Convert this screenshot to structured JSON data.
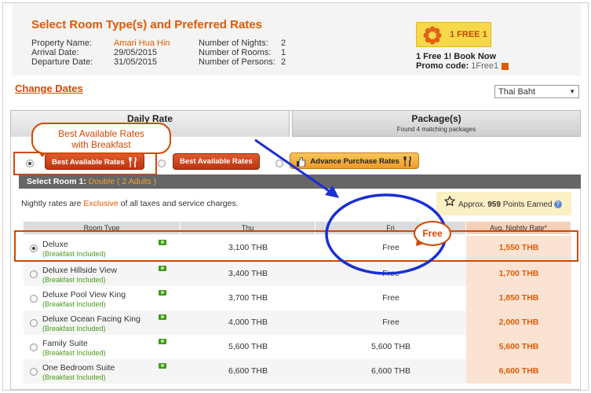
{
  "header": {
    "title": "Select Room Type(s) and Preferred Rates",
    "property_label": "Property Name:",
    "property_value": "Amari Hua Hin",
    "arrival_label": "Arrival Date:",
    "arrival_value": "29/05/2015",
    "departure_label": "Departure Date:",
    "departure_value": "31/05/2015",
    "nights_label": "Number of Nights:",
    "nights_value": "2",
    "rooms_label": "Number of Rooms:",
    "rooms_value": "1",
    "persons_label": "Number of Persons:",
    "persons_value": "2"
  },
  "promo": {
    "banner_text": "1 FREE 1",
    "line1": "1 Free 1! Book Now",
    "code_label": "Promo code: ",
    "code_value": "1Free1"
  },
  "change_dates": "Change Dates",
  "currency": {
    "selected": "Thai Baht"
  },
  "tabs": [
    {
      "label": "Daily Rate",
      "sub": ""
    },
    {
      "label": "Package(s)",
      "sub": "Found 4 matching packages"
    }
  ],
  "rate_options": [
    {
      "label": "Best Available Rates",
      "selected": true,
      "icon": "fork-knife-icon"
    },
    {
      "label": "Best Available Rates",
      "selected": false,
      "icon": ""
    },
    {
      "label": "Advance Purchase Rates",
      "selected": false,
      "icon": "fork-knife-icon"
    }
  ],
  "callout": {
    "line1": "Best Available Rates",
    "line2": "with Breakfast"
  },
  "select_room": {
    "label": "Select Room 1:",
    "value": "Double ( 2 Adults )"
  },
  "nightly_note": {
    "pre": "Nightly rates are ",
    "highlight": "Exclusive",
    "post": " of all taxes and service charges."
  },
  "points": {
    "pre": "Approx. ",
    "value": "959",
    "post": " Points Earned"
  },
  "table": {
    "headers": [
      "Room Type",
      "Thu",
      "Fri",
      "Avg. Nightly Rate*"
    ],
    "rows": [
      {
        "name": "Deluxe",
        "sub": "(Breakfast Included)",
        "thu": "3,100 THB",
        "fri": "Free",
        "avg": "1,550 THB",
        "selected": true
      },
      {
        "name": "Deluxe Hillside View",
        "sub": "(Breakfast Included)",
        "thu": "3,400 THB",
        "fri": "Free",
        "avg": "1,700 THB",
        "selected": false
      },
      {
        "name": "Deluxe Pool View King",
        "sub": "(Breakfast Included)",
        "thu": "3,700 THB",
        "fri": "Free",
        "avg": "1,850 THB",
        "selected": false
      },
      {
        "name": "Deluxe Ocean Facing King",
        "sub": "(Breakfast Included)",
        "thu": "4,000 THB",
        "fri": "Free",
        "avg": "2,000 THB",
        "selected": false
      },
      {
        "name": "Family Suite",
        "sub": "(Breakfast Included)",
        "thu": "5,600 THB",
        "fri": "5,600 THB",
        "avg": "5,600 THB",
        "selected": false
      },
      {
        "name": "One Bedroom Suite",
        "sub": "(Breakfast Included)",
        "thu": "6,600 THB",
        "fri": "6,600 THB",
        "avg": "6,600 THB",
        "selected": false
      }
    ]
  },
  "annotation": {
    "free_label": "Free"
  },
  "colors": {
    "accent": "#e05a00",
    "annotation_blue": "#1a2fd4",
    "annotation_red": "#d24800",
    "green": "#4a9a1a"
  }
}
